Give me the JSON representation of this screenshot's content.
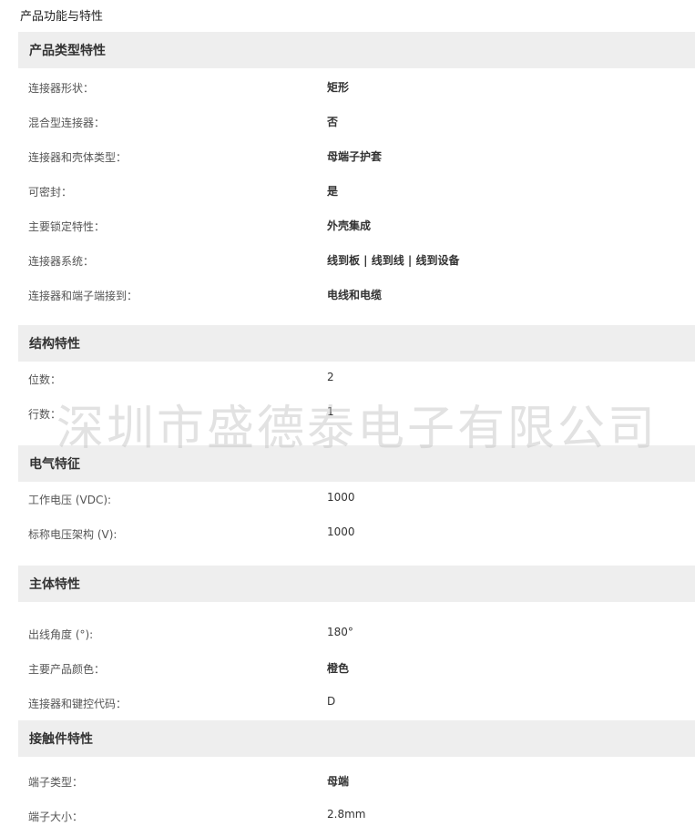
{
  "page": {
    "title": "产品功能与特性",
    "watermark": "深圳市盛德泰电子有限公司"
  },
  "sections": [
    {
      "header": "产品类型特性",
      "rows": [
        {
          "label": "连接器形状：",
          "value": "矩形"
        },
        {
          "label": "混合型连接器：",
          "value": "否"
        },
        {
          "label": "连接器和壳体类型：",
          "value": "母端子护套"
        },
        {
          "label": "可密封：",
          "value": "是"
        },
        {
          "label": "主要锁定特性：",
          "value": "外壳集成"
        },
        {
          "label": "连接器系统：",
          "value": "线到板 | 线到线 | 线到设备"
        },
        {
          "label": "连接器和端子端接到：",
          "value": "电线和电缆"
        }
      ]
    },
    {
      "header": "结构特性",
      "rows": [
        {
          "label": "位数：",
          "value": "2"
        },
        {
          "label": "行数：",
          "value": "1"
        }
      ]
    },
    {
      "header": "电气特征",
      "rows": [
        {
          "label": "工作电压 (VDC):",
          "value": "1000"
        },
        {
          "label": "标称电压架构 (V):",
          "value": "1000"
        }
      ]
    },
    {
      "header": "主体特性",
      "rows": [
        {
          "label": "出线角度 (°):",
          "value": "180°"
        },
        {
          "label": "主要产品颜色：",
          "value": "橙色"
        },
        {
          "label": "连接器和键控代码：",
          "value": "D"
        }
      ]
    },
    {
      "header": "接触件特性",
      "rows": [
        {
          "label": "端子类型：",
          "value": "母端"
        },
        {
          "label": "端子大小：",
          "value": "2.8mm"
        }
      ]
    }
  ]
}
